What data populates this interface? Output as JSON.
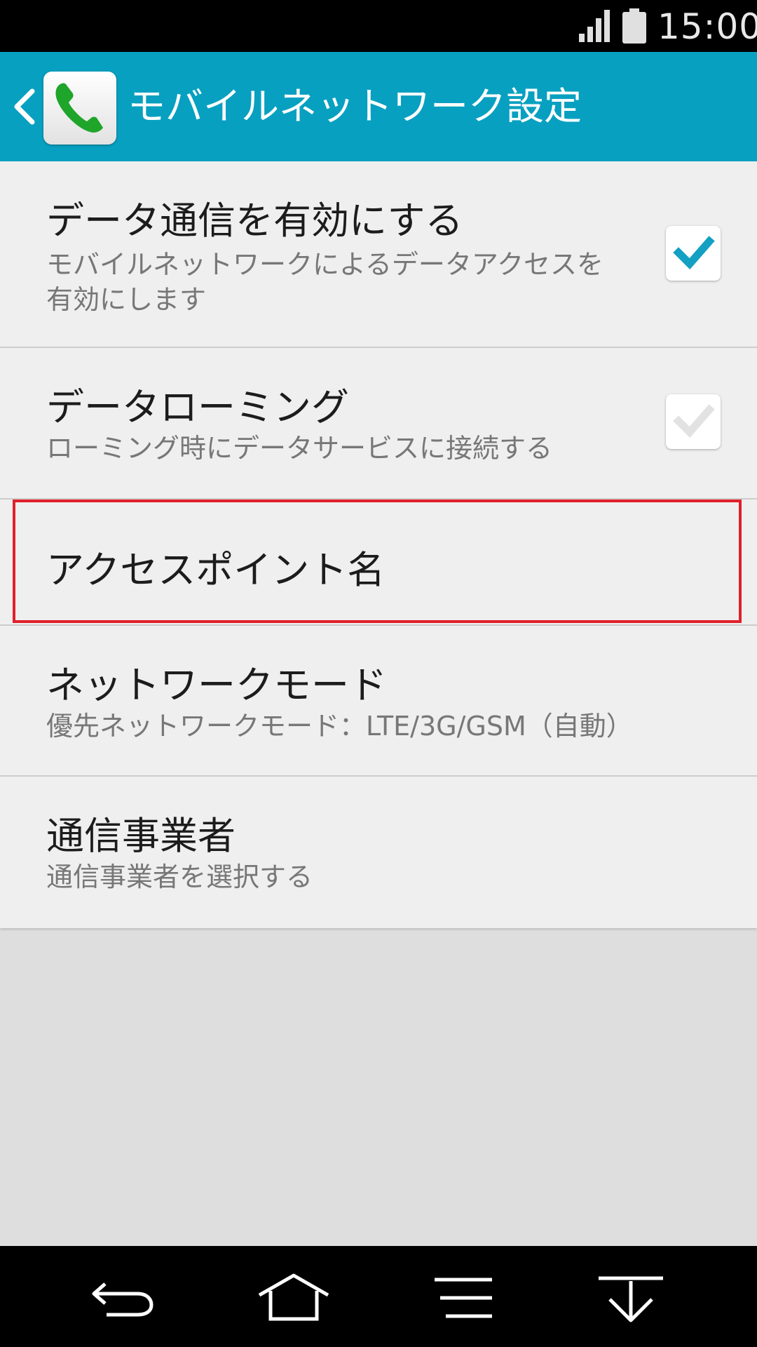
{
  "status_bar": {
    "time": "15:00"
  },
  "action_bar": {
    "title": "モバイルネットワーク設定"
  },
  "settings": {
    "data_enabled": {
      "title": "データ通信を有効にする",
      "summary": "モバイルネットワークによるデータアクセスを有効にします",
      "checked": true
    },
    "data_roaming": {
      "title": "データローミング",
      "summary": "ローミング時にデータサービスに接続する",
      "checked": false
    },
    "apn": {
      "title": "アクセスポイント名"
    },
    "network_mode": {
      "title": "ネットワークモード",
      "summary": "優先ネットワークモード：LTE/3G/GSM（自動）"
    },
    "operator": {
      "title": "通信事業者",
      "summary": "通信事業者を選択する"
    }
  },
  "colors": {
    "accent": "#08a0c0",
    "checked_mark": "#13a0c2",
    "unchecked_mark": "#e2e2e2",
    "highlight": "#e0202a"
  },
  "icons": {
    "back": "back-arrow-icon",
    "app": "phone-icon",
    "nav": [
      "nav-back-icon",
      "nav-home-icon",
      "nav-menu-icon",
      "nav-hide-icon"
    ]
  }
}
